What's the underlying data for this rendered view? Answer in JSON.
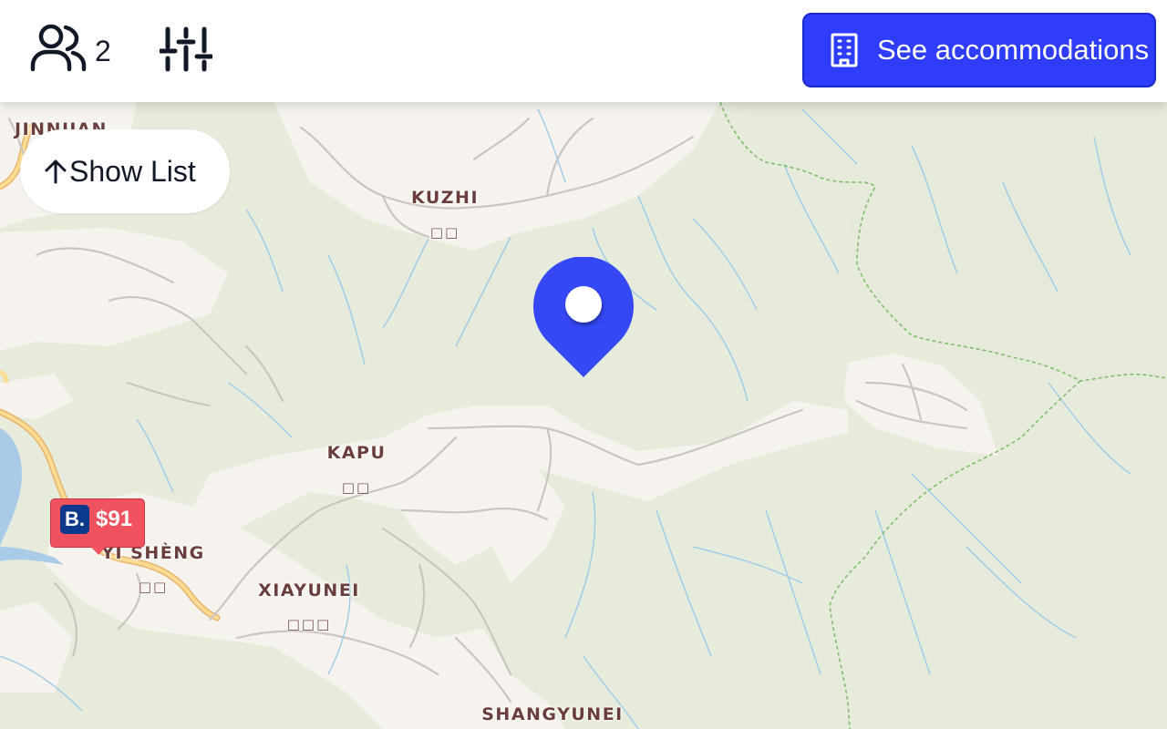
{
  "header": {
    "guests": {
      "count": "2",
      "icon": "users-icon"
    },
    "filters": {
      "icon": "sliders-icon"
    },
    "accommodations_button": {
      "label": "See accommodations",
      "icon": "building-icon",
      "color": "#2d3dfb"
    }
  },
  "show_list": {
    "label": "Show List",
    "icon": "arrow-up-icon"
  },
  "map": {
    "places": [
      {
        "name": "JINNUAN",
        "local": ""
      },
      {
        "name": "KUZHI",
        "local": "□□"
      },
      {
        "name": "KAPU",
        "local": "□□"
      },
      {
        "name": "YI SHÈNG",
        "local": "□□"
      },
      {
        "name": "XIAYUNEI",
        "local": "□□□"
      },
      {
        "name": "SHANGYUNEI",
        "local": ""
      }
    ],
    "selected_pin": {
      "color": "#3448f5"
    },
    "price_marker": {
      "provider": "B.",
      "price": "$91",
      "color": "#f05260"
    }
  }
}
